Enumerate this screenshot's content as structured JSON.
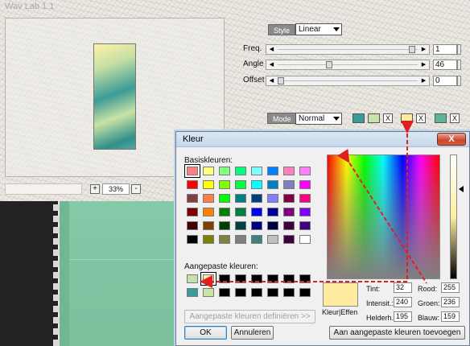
{
  "plugin": {
    "title": "Wav Lab 1.1",
    "zoom": {
      "minus_label": "-",
      "plus_label": "+",
      "value": "33%"
    },
    "style": {
      "tag": "Style",
      "value": "Linear"
    },
    "params": [
      {
        "label": "Freq.",
        "value": "1",
        "level": 0.98
      },
      {
        "label": "Angle",
        "value": "46",
        "level": 0.36
      },
      {
        "label": "Offset",
        "value": "0",
        "level": 0.0
      }
    ],
    "mode": {
      "tag": "Mode",
      "value": "Normal"
    },
    "colors": [
      "#3a9c9a",
      "#c5e3a8",
      "#ffeca0",
      "#5fb39a"
    ],
    "x_label": "X"
  },
  "dialog": {
    "title": "Kleur",
    "close_label": "X",
    "basic_label": "Basiskleuren:",
    "custom_label": "Aangepaste kleuren:",
    "basic_colors": [
      [
        "#ff8080",
        "#ffff80",
        "#80ff80",
        "#00ff80",
        "#80ffff",
        "#0080ff",
        "#ff80c0",
        "#ff80ff"
      ],
      [
        "#ff0000",
        "#ffff00",
        "#80ff00",
        "#00ff40",
        "#00ffff",
        "#0080c0",
        "#8080c0",
        "#ff00ff"
      ],
      [
        "#804040",
        "#ff8040",
        "#00ff00",
        "#008080",
        "#004080",
        "#8080ff",
        "#800040",
        "#ff0080"
      ],
      [
        "#800000",
        "#ff8000",
        "#008000",
        "#008040",
        "#0000ff",
        "#0000a0",
        "#800080",
        "#8000ff"
      ],
      [
        "#400000",
        "#804000",
        "#004000",
        "#004040",
        "#000080",
        "#000040",
        "#400040",
        "#400080"
      ],
      [
        "#000000",
        "#808000",
        "#808040",
        "#808080",
        "#408080",
        "#c0c0c0",
        "#400040",
        "#ffffff"
      ]
    ],
    "custom_colors": [
      [
        "#c5e3a8",
        "#ffeca0",
        "#000000",
        "#000000",
        "#000000",
        "#000000",
        "#000000",
        "#000000"
      ],
      [
        "#3a9c9a",
        "#c8e3a4",
        "#000000",
        "#000000",
        "#000000",
        "#000000",
        "#000000",
        "#000000"
      ]
    ],
    "define_button": "Aangepaste kleuren definiëren >>",
    "ok_button": "OK",
    "cancel_button": "Annuleren",
    "add_button": "Aan aangepaste kleuren toevoegen",
    "preview_label": "Kleur|Effen",
    "preview_color": "#ffeca0",
    "fields": {
      "tint": {
        "label": "Tint:",
        "value": "32"
      },
      "intens": {
        "label": "Intensit.:",
        "value": "240"
      },
      "helder": {
        "label": "Helderh.:",
        "value": "195"
      },
      "rood": {
        "label": "Rood:",
        "value": "255"
      },
      "groen": {
        "label": "Groen:",
        "value": "236"
      },
      "blauw": {
        "label": "Blauw:",
        "value": "159"
      }
    }
  },
  "annotation_color": "#e02020"
}
